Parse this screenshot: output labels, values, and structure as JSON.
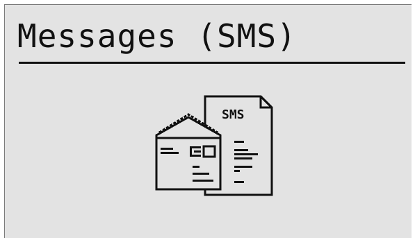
{
  "screen": {
    "title": "Messages (SMS)"
  },
  "icon": {
    "name": "sms-messages-icon",
    "document_label": "SMS"
  },
  "colors": {
    "background": "#e3e3e3",
    "foreground": "#111111"
  }
}
